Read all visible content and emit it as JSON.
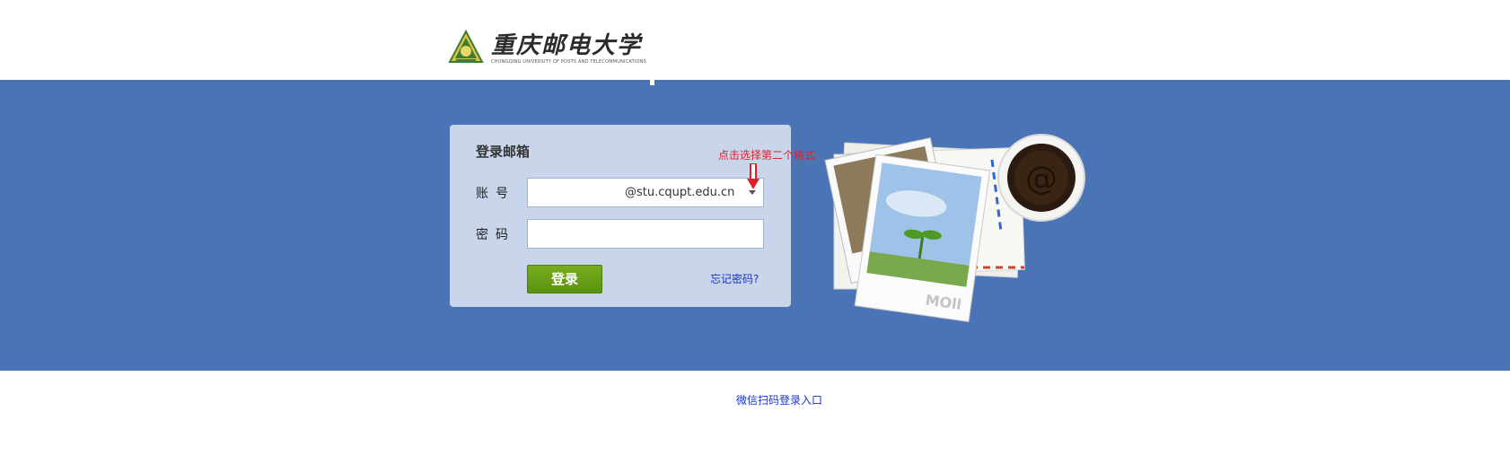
{
  "header": {
    "logo_name": "重庆邮电大学",
    "logo_subtitle": "CHONGQING UNIVERSITY OF POSTS AND TELECOMMUNICATIONS"
  },
  "login": {
    "title": "登录邮箱",
    "account_label": "账号",
    "password_label": "密码",
    "account_value": "",
    "password_value": "",
    "domain_selected": "@stu.cqupt.edu.cn",
    "login_button": "登录",
    "forgot_link": "忘记密码?"
  },
  "annotation": {
    "text": "点击选择第二个格式",
    "color": "#e0202a"
  },
  "illustration": {
    "stamp_text": "MOll",
    "cup_symbol": "@"
  },
  "footer": {
    "wechat_link": "微信扫码登录入口"
  },
  "colors": {
    "band": "#4a74b6",
    "card": "#c8d5ea",
    "button": "#5f9714",
    "link": "#1a33cc"
  },
  "icons": [
    "university-emblem-icon",
    "dropdown-caret-icon",
    "red-down-arrow-icon"
  ]
}
